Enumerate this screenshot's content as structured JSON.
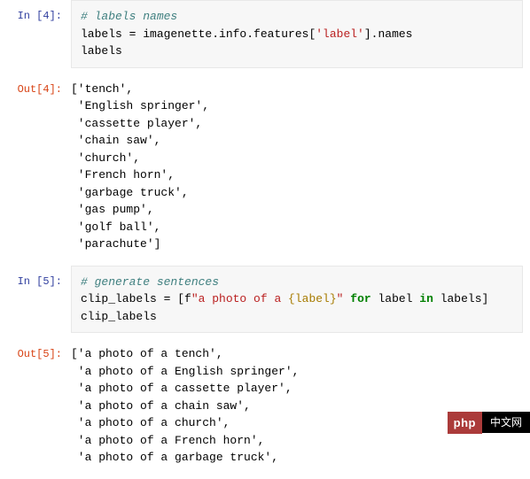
{
  "cells": {
    "in4_prompt": "In [4]:",
    "out4_prompt": "Out[4]:",
    "in5_prompt": "In [5]:",
    "out5_prompt": "Out[5]:"
  },
  "cell4": {
    "comment": "# labels names",
    "line2_a": "labels = imagenette.info.features[",
    "line2_str": "'label'",
    "line2_b": "].names",
    "line3": "labels"
  },
  "out4": {
    "l0": "['tench',",
    "l1": " 'English springer',",
    "l2": " 'cassette player',",
    "l3": " 'chain saw',",
    "l4": " 'church',",
    "l5": " 'French horn',",
    "l6": " 'garbage truck',",
    "l7": " 'gas pump',",
    "l8": " 'golf ball',",
    "l9": " 'parachute']"
  },
  "cell5": {
    "comment": "# generate sentences",
    "line2_a": "clip_labels = [f",
    "line2_s1": "\"a photo of a ",
    "line2_interp": "{label}",
    "line2_s2": "\"",
    "line2_b": " ",
    "line2_for": "for",
    "line2_c": " label ",
    "line2_in": "in",
    "line2_d": " labels]",
    "line3": "clip_labels"
  },
  "out5": {
    "l0": "['a photo of a tench',",
    "l1": " 'a photo of a English springer',",
    "l2": " 'a photo of a cassette player',",
    "l3": " 'a photo of a chain saw',",
    "l4": " 'a photo of a church',",
    "l5": " 'a photo of a French horn',",
    "l6": " 'a photo of a garbage truck',"
  },
  "watermark": {
    "php": "php",
    "cn": "中文网"
  },
  "chart_data": {
    "type": "table",
    "note": "Jupyter notebook cells showing code and outputs",
    "labels_list": [
      "tench",
      "English springer",
      "cassette player",
      "chain saw",
      "church",
      "French horn",
      "garbage truck",
      "gas pump",
      "golf ball",
      "parachute"
    ],
    "clip_labels_visible": [
      "a photo of a tench",
      "a photo of a English springer",
      "a photo of a cassette player",
      "a photo of a chain saw",
      "a photo of a church",
      "a photo of a French horn",
      "a photo of a garbage truck"
    ]
  }
}
